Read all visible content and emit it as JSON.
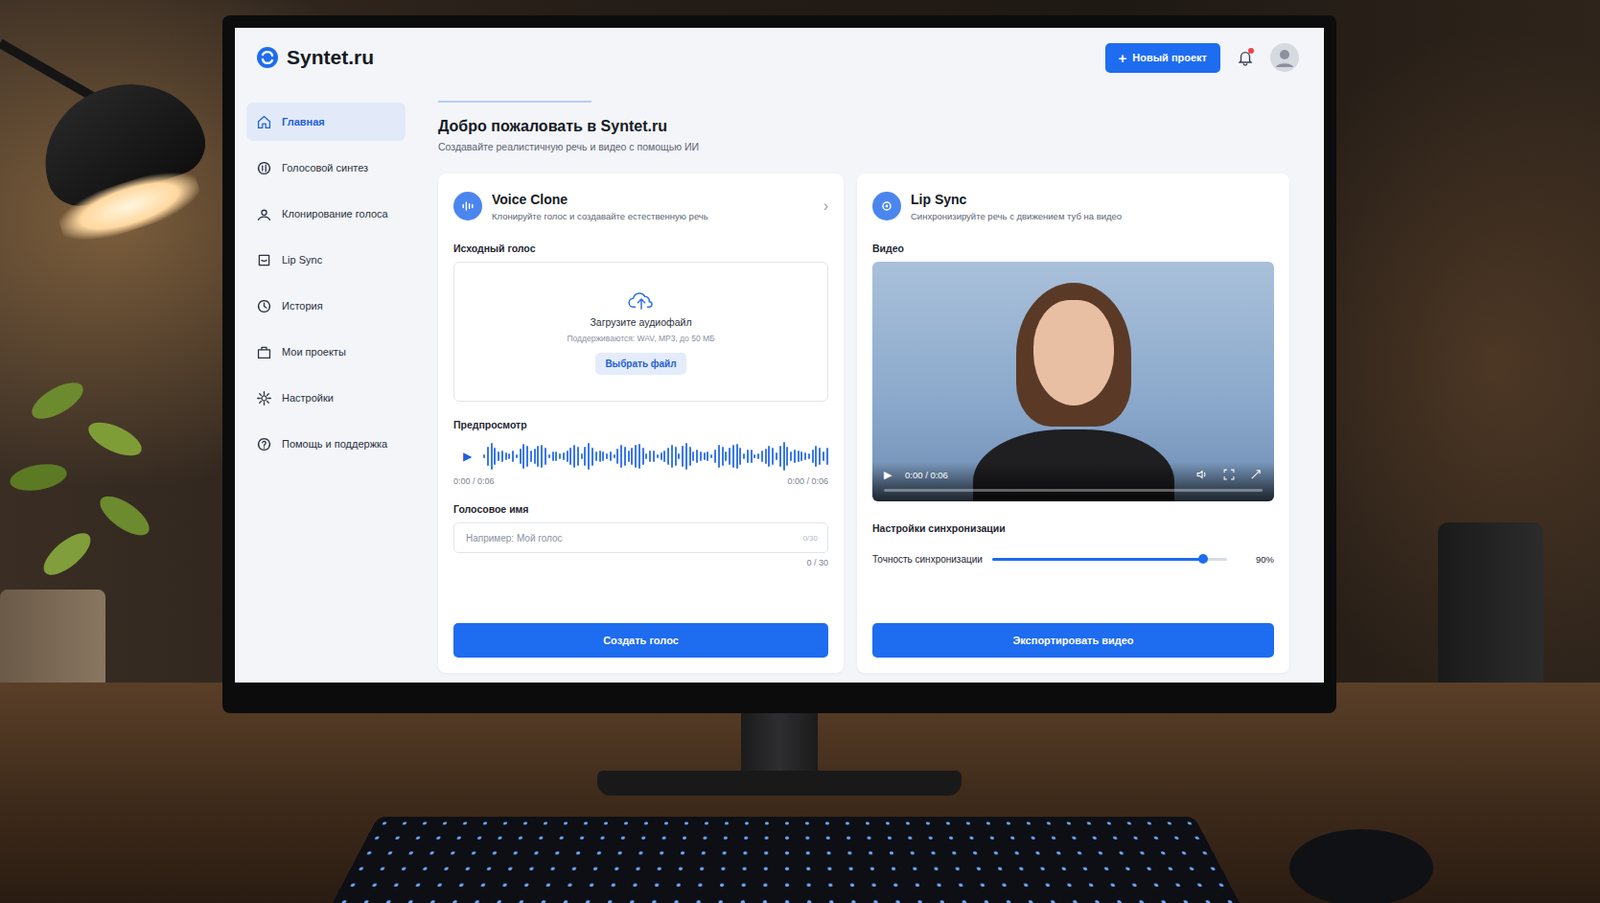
{
  "app": {
    "logo": "Syntet.ru",
    "new_project_icon": "+",
    "new_project_button": "Новый проект",
    "notifications": {
      "unread": true
    }
  },
  "sidebar": {
    "items": [
      {
        "label": "Главная",
        "selected": true
      },
      {
        "label": "Голосовой синтез",
        "selected": false
      },
      {
        "label": "Клонирование голоса",
        "selected": false
      },
      {
        "label": "Lip Sync",
        "selected": false
      },
      {
        "label": "История",
        "selected": false
      },
      {
        "label": "Мои проекты",
        "selected": false
      },
      {
        "label": "Настройки",
        "selected": false
      },
      {
        "label": "Помощь и поддержка",
        "selected": false
      }
    ]
  },
  "page": {
    "title": "Добро пожаловать в Syntet.ru",
    "subtitle": "Создавайте реалистичную речь и видео с помощью ИИ"
  },
  "voice_clone": {
    "title": "Voice Clone",
    "description": "Клонируйте голос и создавайте естественную речь",
    "chevron": "›",
    "source_label": "Исходный голос",
    "upload": {
      "title": "Загрузите аудиофайл",
      "hint": "Поддерживаются: WAV, MP3, до 50 МБ",
      "button": "Выбрать файл"
    },
    "preview": {
      "label": "Предпросмотр",
      "play": "▶",
      "time_left": "0:00 / 0:06",
      "time_right": "0:00 / 0:06",
      "level": 0
    },
    "name_field": {
      "label": "Голосовое имя",
      "placeholder": "Например: Мой голос",
      "counter_inner": "0/30",
      "counter": "0 / 30"
    },
    "button": "Создать голос"
  },
  "lip_sync": {
    "title": "Lip Sync",
    "description": "Синхронизируйте речь с движением туб на видео",
    "video_label": "Видео",
    "player": {
      "play": "▶",
      "time": "0:00 / 0:06",
      "level": 0
    },
    "settings_label": "Настройки синхронизации",
    "slider": {
      "label": "Точность синхронизации",
      "level": 0.9,
      "reading": "90%"
    },
    "button": "Экспортировать видео"
  }
}
